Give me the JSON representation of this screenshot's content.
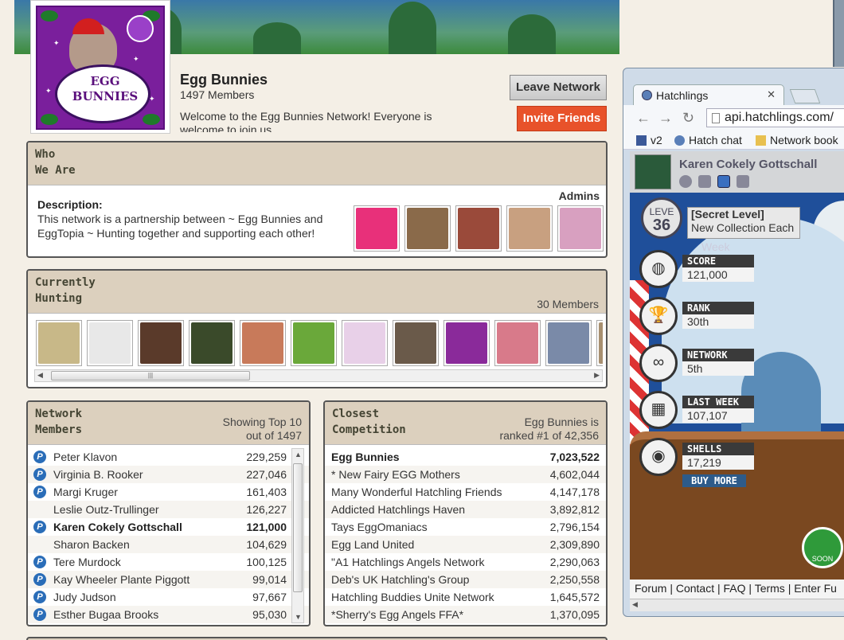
{
  "network": {
    "title": "Egg Bunnies",
    "members": "1497 Members",
    "welcome": "Welcome to the Egg Bunnies Network! Everyone is welcome to join us",
    "logo_text_line1": "EGG",
    "logo_text_line2": "BUNNIES"
  },
  "buttons": {
    "leave": "Leave Network",
    "invite": "Invite Friends"
  },
  "who": {
    "title_line1": "Who",
    "title_line2": "We Are",
    "desc_label": "Description:",
    "desc_text": "This network is a partnership between ~ Egg Bunnies and EggTopia ~ Hunting together and supporting each other!",
    "admins_label": "Admins",
    "admin_colors": [
      "#e8307a",
      "#8a6a4a",
      "#9a4a3a",
      "#c8a080",
      "#d8a0c0"
    ]
  },
  "hunting": {
    "title_line1": "Currently",
    "title_line2": "Hunting",
    "count": "30 Members",
    "thumb_colors": [
      "#c8b888",
      "#e8e8e8",
      "#5a3a2a",
      "#3a4a2a",
      "#c87a5a",
      "#6aa83a",
      "#e8d0e8",
      "#6a5a4a",
      "#8a2a9a",
      "#d87a8a",
      "#7a8aa8",
      "#a89070"
    ]
  },
  "members_panel": {
    "title_line1": "Network",
    "title_line2": "Members",
    "showing_line1": "Showing Top 10",
    "showing_line2": "out of 1497",
    "rows": [
      {
        "name": "Peter Klavon",
        "value": "229,259",
        "icon": true,
        "bold": false
      },
      {
        "name": "Virginia B. Rooker",
        "value": "227,046",
        "icon": true,
        "bold": false
      },
      {
        "name": "Margi Kruger",
        "value": "161,403",
        "icon": true,
        "bold": false
      },
      {
        "name": "Leslie Outz-Trullinger",
        "value": "126,227",
        "icon": false,
        "bold": false
      },
      {
        "name": "Karen Cokely Gottschall",
        "value": "121,000",
        "icon": true,
        "bold": true
      },
      {
        "name": "Sharon Backen",
        "value": "104,629",
        "icon": false,
        "bold": false
      },
      {
        "name": "Tere Murdock",
        "value": "100,125",
        "icon": true,
        "bold": false
      },
      {
        "name": "Kay Wheeler Plante Piggott",
        "value": "99,014",
        "icon": true,
        "bold": false
      },
      {
        "name": "Judy Judson",
        "value": "97,667",
        "icon": true,
        "bold": false
      },
      {
        "name": "Esther Bugaa Brooks",
        "value": "95,030",
        "icon": true,
        "bold": false
      }
    ]
  },
  "competition": {
    "title_line1": "Closest",
    "title_line2": "Competition",
    "rank_line1": "Egg Bunnies is",
    "rank_line2": "ranked #1 of 42,356",
    "rows": [
      {
        "name": "Egg Bunnies",
        "value": "7,023,522",
        "bold": true
      },
      {
        "name": "* New Fairy EGG Mothers",
        "value": "4,602,044",
        "bold": false
      },
      {
        "name": "Many Wonderful Hatchling Friends",
        "value": "4,147,178",
        "bold": false
      },
      {
        "name": "Addicted Hatchlings Haven",
        "value": "3,892,812",
        "bold": false
      },
      {
        "name": "Tays EggOmaniacs",
        "value": "2,796,154",
        "bold": false
      },
      {
        "name": "Egg Land United",
        "value": "2,309,890",
        "bold": false
      },
      {
        "name": "\"A1 Hatchlings Angels Network",
        "value": "2,290,063",
        "bold": false
      },
      {
        "name": "Deb's UK Hatchling's Group",
        "value": "2,250,558",
        "bold": false
      },
      {
        "name": "Hatchling Buddies Unite Network",
        "value": "1,645,572",
        "bold": false
      },
      {
        "name": "*Sherry's Egg Angels FFA*",
        "value": "1,370,095",
        "bold": false
      }
    ]
  },
  "browser": {
    "tab_title": "Hatchlings",
    "url": "api.hatchlings.com/",
    "bookmarks": [
      "v2",
      "Hatch chat",
      "Network book"
    ],
    "user": "Karen Cokely Gottschall",
    "level_num": "36",
    "level_prefix": "LEVE",
    "level_title": "[Secret Level]",
    "level_sub": "New Collection Each",
    "level_week": "Week",
    "stats": [
      {
        "label": "SCORE",
        "value": "121,000",
        "icon": "eggs-icon"
      },
      {
        "label": "RANK",
        "value": "30th",
        "icon": "trophy-icon"
      },
      {
        "label": "NETWORK",
        "value": "5th",
        "icon": "network-icon"
      },
      {
        "label": "LAST WEEK",
        "value": "107,107",
        "icon": "calendar-icon"
      },
      {
        "label": "SHELLS",
        "value": "17,219",
        "icon": "shell-icon"
      }
    ],
    "buy_more": "BUY MORE",
    "soon": "SOON",
    "footer": "Forum | Contact | FAQ | Terms | Enter Fu"
  }
}
